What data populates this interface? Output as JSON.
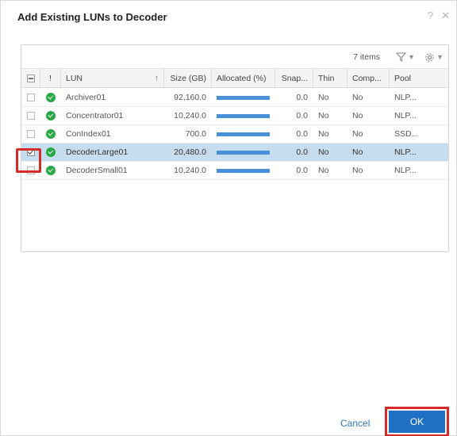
{
  "dialog": {
    "title": "Add Existing LUNs to Decoder",
    "help_icon": "?",
    "close_icon": "✕"
  },
  "toolbar": {
    "item_count": "7 items",
    "filter_icon": "filter-icon",
    "settings_icon": "gear-icon",
    "caret": "▾"
  },
  "columns": {
    "status": "!",
    "lun": "LUN",
    "sort_indicator": "↑",
    "size": "Size (GB)",
    "allocated": "Allocated (%)",
    "snap": "Snap...",
    "thin": "Thin",
    "comp": "Comp...",
    "pool": "Pool"
  },
  "rows": [
    {
      "lun": "Archiver01",
      "size": "92,160.0",
      "allocated_pct": 100,
      "snap": "0.0",
      "thin": "No",
      "comp": "No",
      "pool": "NLP...",
      "checked": false,
      "selected": false
    },
    {
      "lun": "Concentrator01",
      "size": "10,240.0",
      "allocated_pct": 100,
      "snap": "0.0",
      "thin": "No",
      "comp": "No",
      "pool": "NLP...",
      "checked": false,
      "selected": false
    },
    {
      "lun": "ConIndex01",
      "size": "700.0",
      "allocated_pct": 100,
      "snap": "0.0",
      "thin": "No",
      "comp": "No",
      "pool": "SSD...",
      "checked": false,
      "selected": false
    },
    {
      "lun": "DecoderLarge01",
      "size": "20,480.0",
      "allocated_pct": 100,
      "snap": "0.0",
      "thin": "No",
      "comp": "No",
      "pool": "NLP...",
      "checked": true,
      "selected": true
    },
    {
      "lun": "DecoderSmall01",
      "size": "10,240.0",
      "allocated_pct": 100,
      "snap": "0.0",
      "thin": "No",
      "comp": "No",
      "pool": "NLP...",
      "checked": false,
      "selected": false
    }
  ],
  "footer": {
    "cancel_label": "Cancel",
    "ok_label": "OK"
  },
  "colors": {
    "accent": "#1f6fc4",
    "selected_row": "#c6dcef",
    "status_ok": "#27a844",
    "allocation_bar": "#4a90d9",
    "highlight": "#d42a2a"
  }
}
